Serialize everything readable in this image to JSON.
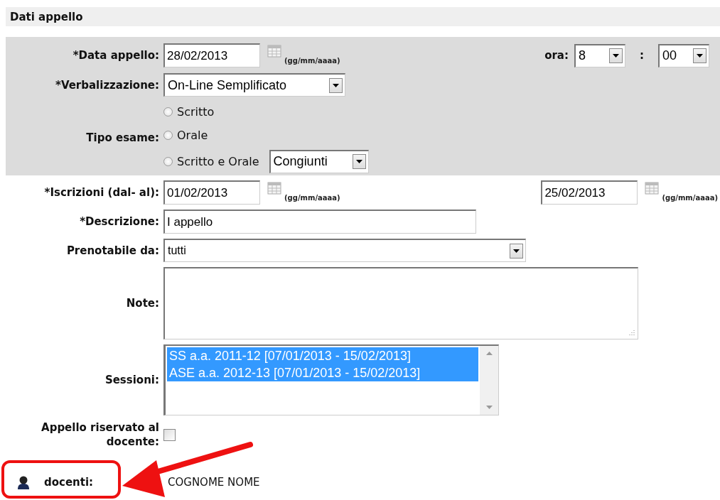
{
  "section_title": "Dati appello",
  "data_appello": {
    "label": "*Data appello:",
    "value": "28/02/2013",
    "hint": "(gg/mm/aaaa)"
  },
  "ora": {
    "label": "ora:",
    "hour": "8",
    "separator": ":",
    "minute": "00"
  },
  "verbalizzazione": {
    "label": "*Verbalizzazione:",
    "value": "On-Line Semplificato"
  },
  "tipo_esame": {
    "label": "Tipo esame:",
    "options": [
      {
        "label": "Scritto",
        "selected": false
      },
      {
        "label": "Orale",
        "selected": false
      },
      {
        "label": "Scritto e Orale",
        "selected": false
      }
    ],
    "mode": "Congiunti"
  },
  "iscrizioni": {
    "label": "*Iscrizioni (dal- al):",
    "from": "01/02/2013",
    "from_hint": "(gg/mm/aaaa)",
    "to": "25/02/2013",
    "to_hint": "(gg/mm/aaaa)"
  },
  "descrizione": {
    "label": "*Descrizione:",
    "value": "I appello"
  },
  "prenotabile": {
    "label": "Prenotabile da:",
    "value": "tutti"
  },
  "note": {
    "label": "Note:"
  },
  "sessioni": {
    "label": "Sessioni:",
    "items": [
      {
        "label": "SS a.a. 2011-12 [07/01/2013 - 15/02/2013]",
        "selected": true
      },
      {
        "label": "ASE a.a. 2012-13 [07/01/2013 - 15/02/2013]",
        "selected": true
      }
    ]
  },
  "riservato": {
    "label": "Appello riservato al docente:",
    "checked": false
  },
  "docenti": {
    "label": "docenti:",
    "value": "COGNOME NOME"
  }
}
